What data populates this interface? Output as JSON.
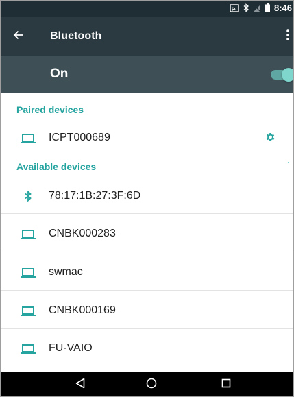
{
  "status_bar": {
    "time": "8:46",
    "icons": [
      "cast-icon",
      "bluetooth-icon",
      "no-signal-icon",
      "battery-icon"
    ]
  },
  "app_bar": {
    "title": "Bluetooth",
    "back_icon": "arrow-left-icon",
    "menu_icon": "overflow-menu-icon"
  },
  "toggle": {
    "label": "On",
    "state": "on",
    "accent_color": "#7fd6cd"
  },
  "paired": {
    "header": "Paired devices",
    "devices": [
      {
        "name": "ICPT000689",
        "icon": "laptop-icon",
        "settings_icon": "gear-icon"
      }
    ]
  },
  "available": {
    "header": "Available devices",
    "devices": [
      {
        "name": "78:17:1B:27:3F:6D",
        "icon": "bluetooth-icon"
      },
      {
        "name": "CNBK000283",
        "icon": "laptop-icon"
      },
      {
        "name": "swmac",
        "icon": "laptop-icon"
      },
      {
        "name": "CNBK000169",
        "icon": "laptop-icon"
      },
      {
        "name": "FU-VAIO",
        "icon": "laptop-icon"
      }
    ]
  },
  "nav_bar": {
    "buttons": [
      "back-triangle-icon",
      "home-circle-icon",
      "recents-square-icon"
    ]
  },
  "colors": {
    "status_bar_bg": "#1f2e34",
    "app_bar_bg": "#2b3a40",
    "toggle_bar_bg": "#3e4f56",
    "accent": "#25a4a0",
    "text": "#212121"
  }
}
